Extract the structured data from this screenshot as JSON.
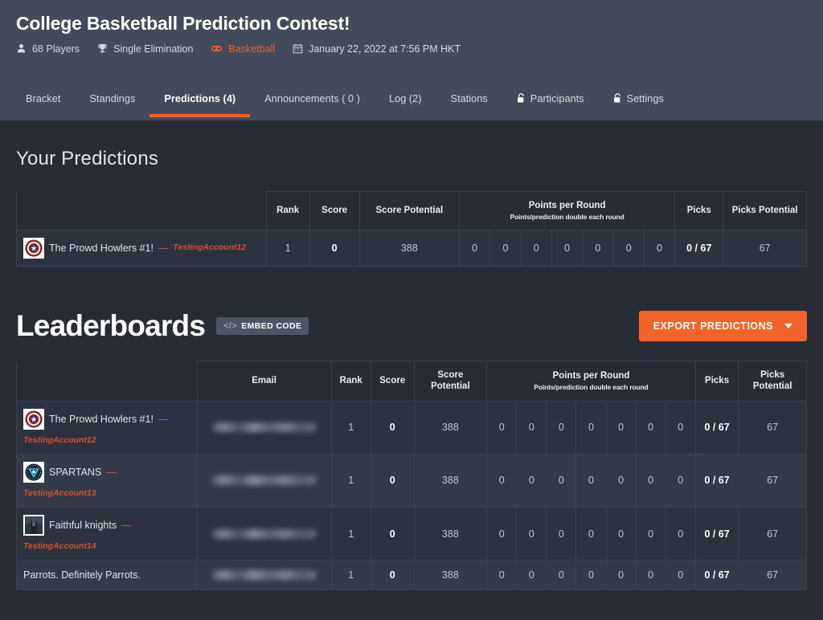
{
  "header": {
    "title": "College Basketball Prediction Contest!",
    "meta": [
      {
        "icon": "person-icon",
        "label": "68 Players",
        "accent": false
      },
      {
        "icon": "trophy-icon",
        "label": "Single Elimination",
        "accent": false
      },
      {
        "icon": "basketball-icon",
        "label": "Basketball",
        "accent": true
      },
      {
        "icon": "calendar-icon",
        "label": "January 22, 2022 at 7:56 PM HKT",
        "accent": false
      }
    ],
    "tabs": [
      {
        "label": "Bracket",
        "active": false,
        "locked": false
      },
      {
        "label": "Standings",
        "active": false,
        "locked": false
      },
      {
        "label": "Predictions (4)",
        "active": true,
        "locked": false
      },
      {
        "label": "Announcements ( 0 )",
        "active": false,
        "locked": false
      },
      {
        "label": "Log (2)",
        "active": false,
        "locked": false
      },
      {
        "label": "Stations",
        "active": false,
        "locked": false
      },
      {
        "label": "Participants",
        "active": false,
        "locked": true
      },
      {
        "label": "Settings",
        "active": false,
        "locked": true
      }
    ]
  },
  "your_predictions": {
    "section_title": "Your Predictions",
    "columns": {
      "player": "",
      "rank": "Rank",
      "score": "Score",
      "score_potential": "Score Potential",
      "points_per_round": "Points per Round",
      "points_per_round_sub": "Points/prediction double each round",
      "picks": "Picks",
      "picks_potential": "Picks Potential"
    },
    "rows": [
      {
        "avatar": "captain-america-shield-avatar",
        "name": "The Prowd Howlers #1!",
        "separator": "—",
        "handle": "TestingAccount12",
        "rank": "1",
        "score": "0",
        "score_potential": "388",
        "rounds": [
          "0",
          "0",
          "0",
          "0",
          "0",
          "0",
          "0"
        ],
        "picks": "0 / 67",
        "picks_potential": "67"
      }
    ]
  },
  "leaderboards": {
    "title": "Leaderboards",
    "embed_button": "EMBED CODE",
    "embed_glyph": "</>",
    "export_button": "EXPORT PREDICTIONS",
    "columns": {
      "player": "",
      "email": "Email",
      "rank": "Rank",
      "score": "Score",
      "score_potential": "Score Potential",
      "points_per_round": "Points per Round",
      "points_per_round_sub": "Points/prediction double each round",
      "picks": "Picks",
      "picks_potential": "Picks Potential"
    },
    "rows": [
      {
        "avatar": "captain-america-shield-avatar",
        "name": "The Prowd Howlers #1!",
        "separator": "—",
        "handle": "TestingAccount12",
        "email": "",
        "rank": "1",
        "score": "0",
        "score_potential": "388",
        "rounds": [
          "0",
          "0",
          "0",
          "0",
          "0",
          "0",
          "0"
        ],
        "picks": "0 / 67",
        "picks_potential": "67"
      },
      {
        "avatar": "arc-reactor-avatar",
        "name": "SPARTANS",
        "separator": "—",
        "handle": "TestingAccount13",
        "email": "",
        "rank": "1",
        "score": "0",
        "score_potential": "388",
        "rounds": [
          "0",
          "0",
          "0",
          "0",
          "0",
          "0",
          "0"
        ],
        "picks": "0 / 67",
        "picks_potential": "67"
      },
      {
        "avatar": "knight-photo-avatar",
        "name": "Faithful knights",
        "separator": "—",
        "handle": "TestingAccount14",
        "email": "",
        "rank": "1",
        "score": "0",
        "score_potential": "388",
        "rounds": [
          "0",
          "0",
          "0",
          "0",
          "0",
          "0",
          "0"
        ],
        "picks": "0 / 67",
        "picks_potential": "67"
      },
      {
        "avatar": "",
        "name": "Parrots. Definitely Parrots.",
        "separator": "",
        "handle": "",
        "email": "",
        "rank": "1",
        "score": "0",
        "score_potential": "388",
        "rounds": [
          "0",
          "0",
          "0",
          "0",
          "0",
          "0",
          "0"
        ],
        "picks": "0 / 67",
        "picks_potential": "67"
      }
    ]
  },
  "colors": {
    "header_bg": "#434a5c",
    "body_bg": "#282c37",
    "accent_orange": "#ef6024",
    "export_orange": "#f1652a",
    "handle_red": "#d9512c",
    "row_bg": "#2d3240",
    "row_alt_bg": "#343a49",
    "border": "#3b4151"
  }
}
